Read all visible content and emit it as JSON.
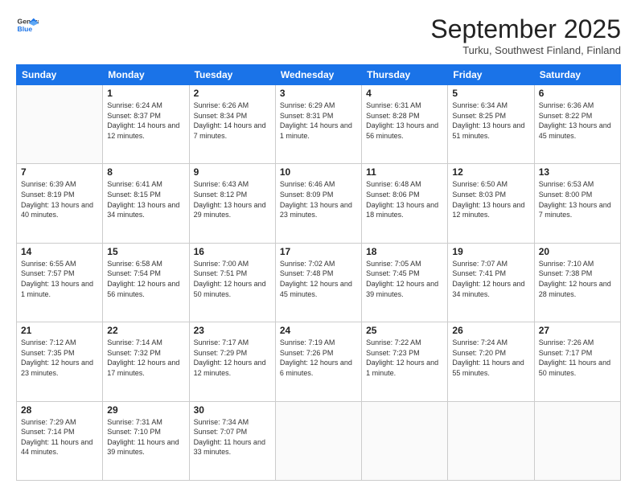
{
  "header": {
    "logo_line1": "General",
    "logo_line2": "Blue",
    "month": "September 2025",
    "location": "Turku, Southwest Finland, Finland"
  },
  "days_of_week": [
    "Sunday",
    "Monday",
    "Tuesday",
    "Wednesday",
    "Thursday",
    "Friday",
    "Saturday"
  ],
  "weeks": [
    [
      {
        "day": "",
        "sunrise": "",
        "sunset": "",
        "daylight": ""
      },
      {
        "day": "1",
        "sunrise": "6:24 AM",
        "sunset": "8:37 PM",
        "daylight": "14 hours and 12 minutes."
      },
      {
        "day": "2",
        "sunrise": "6:26 AM",
        "sunset": "8:34 PM",
        "daylight": "14 hours and 7 minutes."
      },
      {
        "day": "3",
        "sunrise": "6:29 AM",
        "sunset": "8:31 PM",
        "daylight": "14 hours and 1 minute."
      },
      {
        "day": "4",
        "sunrise": "6:31 AM",
        "sunset": "8:28 PM",
        "daylight": "13 hours and 56 minutes."
      },
      {
        "day": "5",
        "sunrise": "6:34 AM",
        "sunset": "8:25 PM",
        "daylight": "13 hours and 51 minutes."
      },
      {
        "day": "6",
        "sunrise": "6:36 AM",
        "sunset": "8:22 PM",
        "daylight": "13 hours and 45 minutes."
      }
    ],
    [
      {
        "day": "7",
        "sunrise": "6:39 AM",
        "sunset": "8:19 PM",
        "daylight": "13 hours and 40 minutes."
      },
      {
        "day": "8",
        "sunrise": "6:41 AM",
        "sunset": "8:15 PM",
        "daylight": "13 hours and 34 minutes."
      },
      {
        "day": "9",
        "sunrise": "6:43 AM",
        "sunset": "8:12 PM",
        "daylight": "13 hours and 29 minutes."
      },
      {
        "day": "10",
        "sunrise": "6:46 AM",
        "sunset": "8:09 PM",
        "daylight": "13 hours and 23 minutes."
      },
      {
        "day": "11",
        "sunrise": "6:48 AM",
        "sunset": "8:06 PM",
        "daylight": "13 hours and 18 minutes."
      },
      {
        "day": "12",
        "sunrise": "6:50 AM",
        "sunset": "8:03 PM",
        "daylight": "13 hours and 12 minutes."
      },
      {
        "day": "13",
        "sunrise": "6:53 AM",
        "sunset": "8:00 PM",
        "daylight": "13 hours and 7 minutes."
      }
    ],
    [
      {
        "day": "14",
        "sunrise": "6:55 AM",
        "sunset": "7:57 PM",
        "daylight": "13 hours and 1 minute."
      },
      {
        "day": "15",
        "sunrise": "6:58 AM",
        "sunset": "7:54 PM",
        "daylight": "12 hours and 56 minutes."
      },
      {
        "day": "16",
        "sunrise": "7:00 AM",
        "sunset": "7:51 PM",
        "daylight": "12 hours and 50 minutes."
      },
      {
        "day": "17",
        "sunrise": "7:02 AM",
        "sunset": "7:48 PM",
        "daylight": "12 hours and 45 minutes."
      },
      {
        "day": "18",
        "sunrise": "7:05 AM",
        "sunset": "7:45 PM",
        "daylight": "12 hours and 39 minutes."
      },
      {
        "day": "19",
        "sunrise": "7:07 AM",
        "sunset": "7:41 PM",
        "daylight": "12 hours and 34 minutes."
      },
      {
        "day": "20",
        "sunrise": "7:10 AM",
        "sunset": "7:38 PM",
        "daylight": "12 hours and 28 minutes."
      }
    ],
    [
      {
        "day": "21",
        "sunrise": "7:12 AM",
        "sunset": "7:35 PM",
        "daylight": "12 hours and 23 minutes."
      },
      {
        "day": "22",
        "sunrise": "7:14 AM",
        "sunset": "7:32 PM",
        "daylight": "12 hours and 17 minutes."
      },
      {
        "day": "23",
        "sunrise": "7:17 AM",
        "sunset": "7:29 PM",
        "daylight": "12 hours and 12 minutes."
      },
      {
        "day": "24",
        "sunrise": "7:19 AM",
        "sunset": "7:26 PM",
        "daylight": "12 hours and 6 minutes."
      },
      {
        "day": "25",
        "sunrise": "7:22 AM",
        "sunset": "7:23 PM",
        "daylight": "12 hours and 1 minute."
      },
      {
        "day": "26",
        "sunrise": "7:24 AM",
        "sunset": "7:20 PM",
        "daylight": "11 hours and 55 minutes."
      },
      {
        "day": "27",
        "sunrise": "7:26 AM",
        "sunset": "7:17 PM",
        "daylight": "11 hours and 50 minutes."
      }
    ],
    [
      {
        "day": "28",
        "sunrise": "7:29 AM",
        "sunset": "7:14 PM",
        "daylight": "11 hours and 44 minutes."
      },
      {
        "day": "29",
        "sunrise": "7:31 AM",
        "sunset": "7:10 PM",
        "daylight": "11 hours and 39 minutes."
      },
      {
        "day": "30",
        "sunrise": "7:34 AM",
        "sunset": "7:07 PM",
        "daylight": "11 hours and 33 minutes."
      },
      {
        "day": "",
        "sunrise": "",
        "sunset": "",
        "daylight": ""
      },
      {
        "day": "",
        "sunrise": "",
        "sunset": "",
        "daylight": ""
      },
      {
        "day": "",
        "sunrise": "",
        "sunset": "",
        "daylight": ""
      },
      {
        "day": "",
        "sunrise": "",
        "sunset": "",
        "daylight": ""
      }
    ]
  ]
}
